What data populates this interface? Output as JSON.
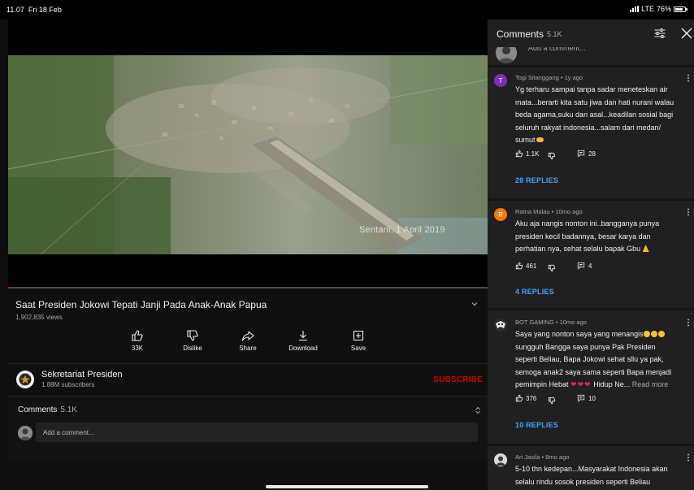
{
  "status_bar": {
    "time": "11.07",
    "date": "Fri 18 Feb",
    "network": "LTE",
    "battery": "76%"
  },
  "video": {
    "overlay_text": "Sentani, 1 April 2019",
    "title": "Saat Presiden Jokowi Tepati Janji Pada Anak-Anak Papua",
    "views": "1,902,835 views",
    "actions": [
      {
        "icon": "thumb-up-icon",
        "label": "33K"
      },
      {
        "icon": "thumb-down-icon",
        "label": "Dislike"
      },
      {
        "icon": "share-icon",
        "label": "Share"
      },
      {
        "icon": "download-icon",
        "label": "Download"
      },
      {
        "icon": "save-icon",
        "label": "Save"
      }
    ]
  },
  "channel": {
    "name": "Sekretariat Presiden",
    "subscribers": "1.88M subscribers",
    "subscribe_label": "SUBSCRIBE"
  },
  "comments_summary": {
    "label": "Comments",
    "count": "5.1K",
    "add_placeholder": "Add a comment..."
  },
  "panel": {
    "title": "Comments",
    "count": "5.1K",
    "add_placeholder": "Add a comment...",
    "comments": [
      {
        "initial": "T",
        "avatar_color": "#7b2fbe",
        "meta": "Togi Sitanggang • 1y ago",
        "lines": [
          "Yg terharu sampai tanpa sadar meneteskan air",
          "mata...berarti kita satu jiwa dan hati nurani walau",
          "beda agama,suku dan asal...keadilan sosial bagi",
          "seluruh rakyat indonesia...salam dari medan/",
          "sumut"
        ],
        "likes": "1.1K",
        "replies_count": "28",
        "replies_label": "28 REPLIES"
      },
      {
        "initial": "R",
        "avatar_color": "#f57c00",
        "meta": "Ratna Malau • 10mo ago",
        "lines": [
          "Aku aja nangis nonton ini..bangganya punya",
          "presiden kecil badannya, besar karya dan",
          "perhatian nya, sehat selalu bapak Gbu"
        ],
        "likes": "461",
        "replies_count": "4",
        "replies_label": "4 REPLIES"
      },
      {
        "initial": "",
        "avatar_color": "#2b2b2b",
        "meta": "BOT GAMING • 10mo ago",
        "lines": [
          "Saya yang nonton saya yang menangis",
          "sungguh Bangga saya punya Pak Presiden",
          "seperti Beliau, Bapa Jokowi sehat sllu ya pak,",
          "semoga anak2 saya sama seperti Bapa menjadi",
          "pemimpin Hebat"
        ],
        "line5_tail": "Hidup Ne...",
        "read_more": "Read more",
        "likes": "376",
        "replies_count": "10",
        "replies_label": "10 REPLIES"
      },
      {
        "initial": "",
        "avatar_color": "#dcdcdc",
        "meta": "Ari Jasila • 8mo ago",
        "lines": [
          "5-10 thn kedepan...Masyarakat Indonesia akan",
          "selalu rindu sosok presiden seperti Beliau"
        ]
      }
    ]
  },
  "colors": {
    "background": "#0f0f0f",
    "panel": "#202020",
    "subscribe": "#cc0000",
    "replies_link": "#3ea6ff",
    "progress": "#ff0000"
  }
}
